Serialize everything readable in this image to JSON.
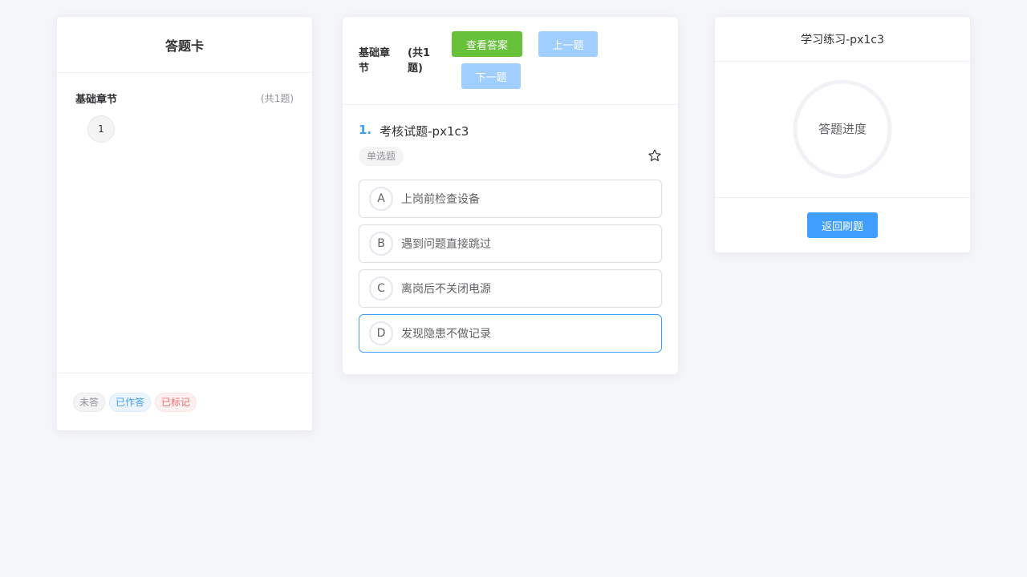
{
  "answer_card": {
    "title": "答题卡",
    "section": {
      "name": "基础章节",
      "count": "(共1题)"
    },
    "question_numbers": [
      "1"
    ],
    "legend": {
      "unanswered": "未答",
      "answered": "已作答",
      "marked": "已标记"
    }
  },
  "question_panel": {
    "chapter_name": "基础章节",
    "chapter_count": "(共1题)",
    "buttons": {
      "view_answer": "查看答案",
      "prev": "上一题",
      "next": "下一题"
    },
    "question": {
      "number": "1.",
      "text": "考核试题-px1c3",
      "type": "单选题",
      "options": [
        {
          "letter": "A",
          "text": "上岗前检查设备",
          "selected": false
        },
        {
          "letter": "B",
          "text": "遇到问题直接跳过",
          "selected": false
        },
        {
          "letter": "C",
          "text": "离岗后不关闭电源",
          "selected": false
        },
        {
          "letter": "D",
          "text": "发现隐患不做记录",
          "selected": true
        }
      ]
    }
  },
  "practice_panel": {
    "title": "学习练习-px1c3",
    "progress_label": "答题进度",
    "progress_value": 0,
    "back_button": "返回刷题"
  },
  "colors": {
    "primary": "#409eff",
    "success": "#67c23a",
    "primary_light": "#a0cfff"
  },
  "icons": {
    "favorite": "star-outline-icon"
  }
}
